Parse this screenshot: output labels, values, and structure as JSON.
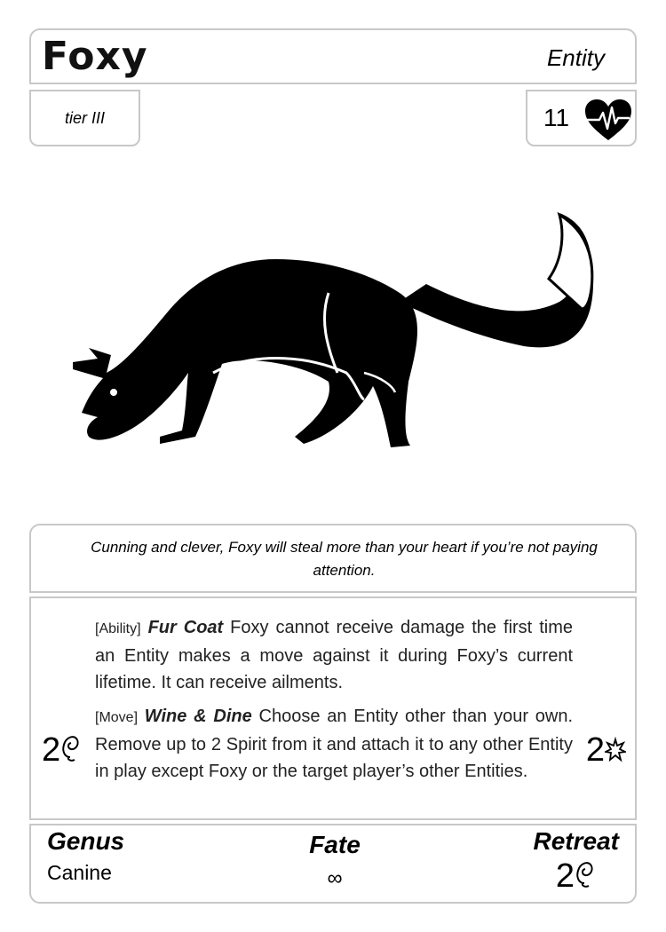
{
  "card": {
    "name": "Foxy",
    "type": "Entity",
    "tier": "tier III",
    "hp": "11",
    "hp_icon": "heart-pulse-icon",
    "flavor": "Cunning and clever, Foxy will steal more than your heart if you’re not paying attention.",
    "abilities": [
      {
        "tag": "[Ability]",
        "name": "Fur Coat",
        "text": " Foxy cannot receive damage the first time an Entity makes a move against it during Foxy’s current lifetime. It can receive ailments."
      },
      {
        "tag": "[Move]",
        "name": "Wine & Dine",
        "text": " Choose an Entity other than your own. Remove up to 2 Spirit from it and attach it to any other Entity in play except Foxy or the target player’s other Entities."
      }
    ],
    "move_cost": {
      "value": "2",
      "icon": "spirit-icon"
    },
    "move_damage": {
      "value": "2",
      "icon": "burst-icon"
    },
    "genus_label": "Genus",
    "genus": "Canine",
    "fate_label": "Fate",
    "fate": "∞",
    "retreat_label": "Retreat",
    "retreat_cost": {
      "value": "2",
      "icon": "spirit-icon"
    }
  }
}
